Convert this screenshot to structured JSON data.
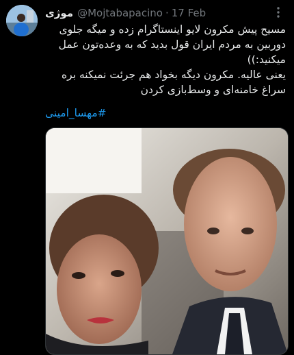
{
  "tweet": {
    "author": {
      "display_name": "موژی",
      "handle": "@Mojtabapacino",
      "separator": "·",
      "date": "17 Feb"
    },
    "text_lines": [
      "مسیح پیش مکرون لایو اینستاگرام زده و میگه جلوی دوربین به مردم ایران قول بدید که به وعده‌تون عمل میکنید:))",
      "یعنی عالیه. مکرون دیگه بخواد هم جرئت نمیکنه بره سراغ خامنه‌ای و وسط‌بازی کردن"
    ],
    "hashtag": "#مهسا_امینی",
    "icons": {
      "more": "more-options-icon",
      "avatar": "avatar"
    },
    "colors": {
      "background": "#000000",
      "text": "#e7e9ea",
      "muted": "#71767b",
      "accent": "#1d9bf0"
    }
  }
}
